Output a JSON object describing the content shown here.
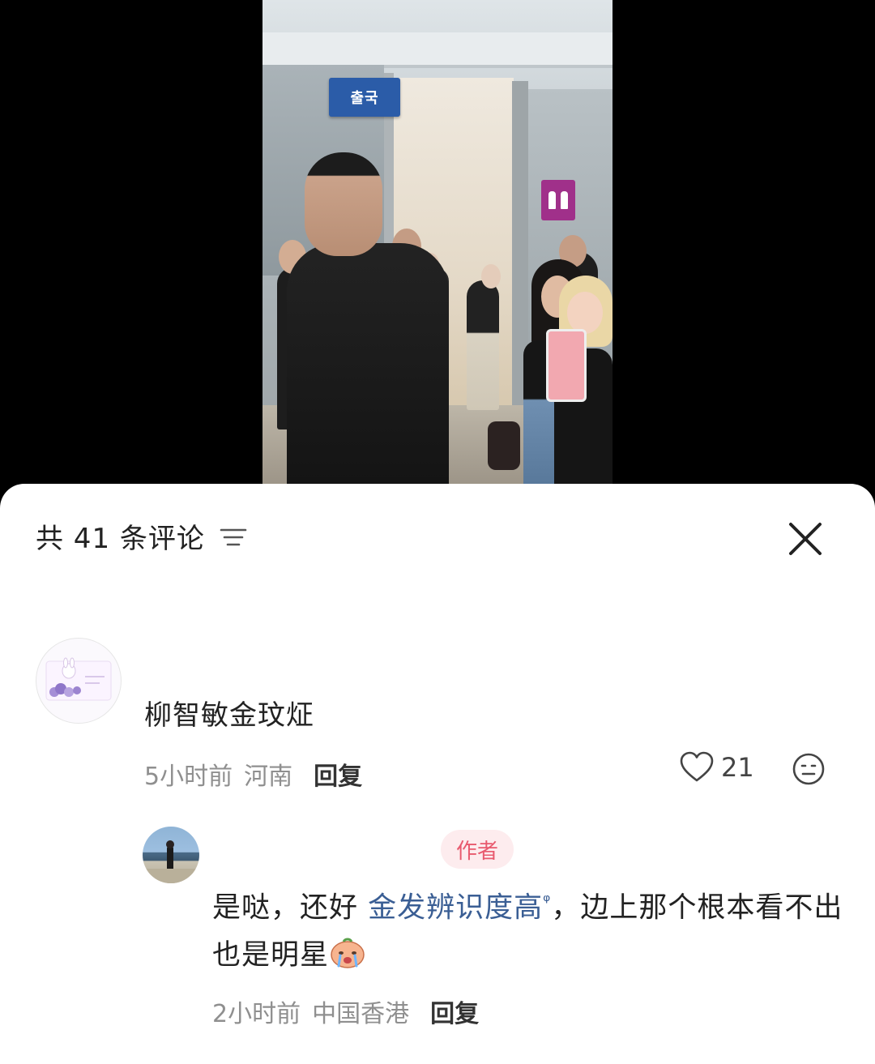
{
  "video": {
    "blue_sign_text": "출국",
    "description_icons": [
      "restroom-sign-icon"
    ]
  },
  "comments_panel": {
    "title": "共 41 条评论",
    "sort_icon": "sort-lines-icon",
    "close_icon": "close-x-icon"
  },
  "comment": {
    "username": "柳智敏金玟炡",
    "time": "5小时前",
    "location": "河南",
    "reply_label": "回复",
    "like_icon": "heart-outline-icon",
    "like_count": "21",
    "emoji_icon": "smiley-face-icon"
  },
  "reply": {
    "badge": "作者",
    "text_before": "是哒，还好 ",
    "link_text": "金发辨识度高",
    "search_mark": "ᵠ",
    "text_after": "，边上那个根本看不出也是明星",
    "sticker_icon": "crying-peach-sticker-icon",
    "time": "2小时前",
    "location": "中国香港",
    "reply_label": "回复"
  }
}
